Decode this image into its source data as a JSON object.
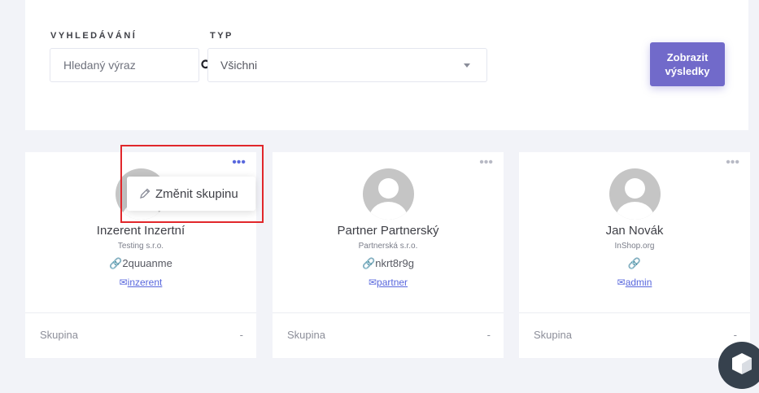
{
  "filters": {
    "search_label": "VYHLEDÁVÁNÍ",
    "search_placeholder": "Hledaný výraz",
    "type_label": "TYP",
    "type_value": "Všichni",
    "submit_line1": "Zobrazit",
    "submit_line2": "výsledky",
    "accent_color": "#716aca"
  },
  "cards": [
    {
      "name": "Inzerent Inzertní",
      "company": "Testing s.r.o.",
      "ref": "2quuanme",
      "email": "inzerent",
      "footer_label": "Skupina",
      "footer_value": "-"
    },
    {
      "name": "Partner Partnerský",
      "company": "Partnerská s.r.o.",
      "ref": "nkrt8r9g",
      "email": "partner",
      "footer_label": "Skupina",
      "footer_value": "-"
    },
    {
      "name": "Jan Novák",
      "company": "InShop.org",
      "ref": "",
      "email": "admin",
      "footer_label": "Skupina",
      "footer_value": "-"
    }
  ],
  "menu": {
    "dots_icon": "more-horizontal-icon",
    "popup_item": "Změnit skupinu",
    "popup_icon": "pencil-icon"
  },
  "icons": {
    "search": "search-icon",
    "dropdown": "caret-down-icon",
    "link": "link-icon",
    "email": "envelope-icon",
    "avatar": "user-avatar-icon",
    "chat": "chat-widget-icon"
  },
  "highlight_color": "#e1272b"
}
